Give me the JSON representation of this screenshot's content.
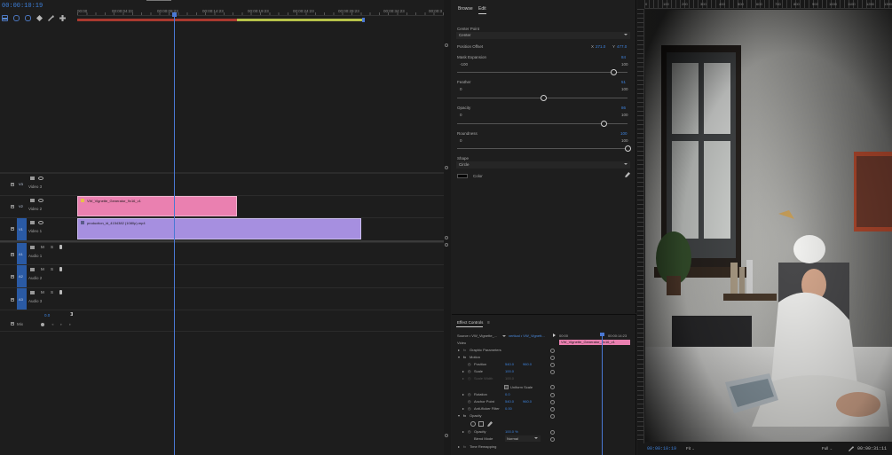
{
  "timeline": {
    "timecode": "00:00:10:19",
    "ruler_labels": [
      "00:00",
      "00:00:04:23",
      "00:00:09:23",
      "00:00:14:23",
      "00:00:19:23",
      "00:00:24:23",
      "00:00:29:23",
      "00:00:34:23",
      "00:00:3"
    ],
    "tracks": {
      "v3": {
        "target": "V3",
        "name": "Video 3"
      },
      "v2": {
        "target": "V2",
        "name": "Video 2"
      },
      "v1": {
        "target": "V1",
        "name": "Video 1"
      },
      "a1": {
        "target": "A1",
        "name": "Audio 1"
      },
      "a2": {
        "target": "A2",
        "name": "Audio 2"
      },
      "a3": {
        "target": "A3",
        "name": "Audio 3"
      },
      "mix": {
        "name": "Mix",
        "value": "0.0"
      }
    },
    "mute_label": "M",
    "solo_label": "S",
    "clips": {
      "pink": "VW_Vignette_Generator_9x16_v1",
      "purple": "production_id_4154382 (1080p).mp4"
    },
    "colors": {
      "pink": "#ea80b0",
      "purple": "#a68fe0",
      "accent": "#3d7fd9"
    }
  },
  "mask_controls": {
    "tabs": {
      "browse": "Browse",
      "edit": "Edit"
    },
    "center_point": {
      "label": "Center Point",
      "value": "Center"
    },
    "position_offset": {
      "label": "Position Offset",
      "x_label": "X",
      "x": "271.0",
      "y_label": "Y",
      "y": "477.0"
    },
    "mask_expansion": {
      "label": "Mask Expansion",
      "value": "84",
      "min": "-100",
      "max": "100"
    },
    "feather": {
      "label": "Feather",
      "value": "51",
      "min": "0",
      "max": "100"
    },
    "opacity": {
      "label": "Opacity",
      "value": "86",
      "min": "0",
      "max": "100"
    },
    "roundness": {
      "label": "Roundness",
      "value": "100",
      "min": "0",
      "max": "100"
    },
    "shape": {
      "label": "Shape",
      "value": "Circle"
    },
    "color": {
      "label": "Color"
    }
  },
  "effect_controls": {
    "title": "Effect Controls",
    "source": "Source • VW_Vignette_...",
    "sequence": "vertical • VW_Vignett...",
    "timeline_start": "00:00",
    "timeline_mark": "00:00:14:23",
    "clip_name": "VW_Vignette_Generator_9x16_v1",
    "section": "Video",
    "rows": {
      "graphic_params": "Graphic Parameters",
      "motion": "Motion",
      "position": {
        "label": "Position",
        "x": "540.0",
        "y": "960.0"
      },
      "scale": {
        "label": "Scale",
        "value": "100.0"
      },
      "scale_width": {
        "label": "Scale Width",
        "value": "100.0"
      },
      "uniform_scale": "Uniform Scale",
      "rotation": {
        "label": "Rotation",
        "value": "0.0"
      },
      "anchor_point": {
        "label": "Anchor Point",
        "x": "540.0",
        "y": "960.0"
      },
      "anti_flicker": {
        "label": "Anti-flicker Filter",
        "value": "0.00"
      },
      "opacity_section": "Opacity",
      "opacity": {
        "label": "Opacity",
        "value": "100.0 %"
      },
      "blend_mode": {
        "label": "Blend Mode",
        "value": "Normal"
      },
      "time_remapping": "Time Remapping"
    }
  },
  "program": {
    "ruler_labels": [
      "0",
      "100",
      "200",
      "300",
      "400",
      "500",
      "600",
      "700",
      "800",
      "900",
      "1000",
      "1100",
      "1200",
      "1300"
    ],
    "timecode": "00:00:10:19",
    "fit": "Fit",
    "resolution": "Full",
    "duration": "00:00:31:11"
  }
}
